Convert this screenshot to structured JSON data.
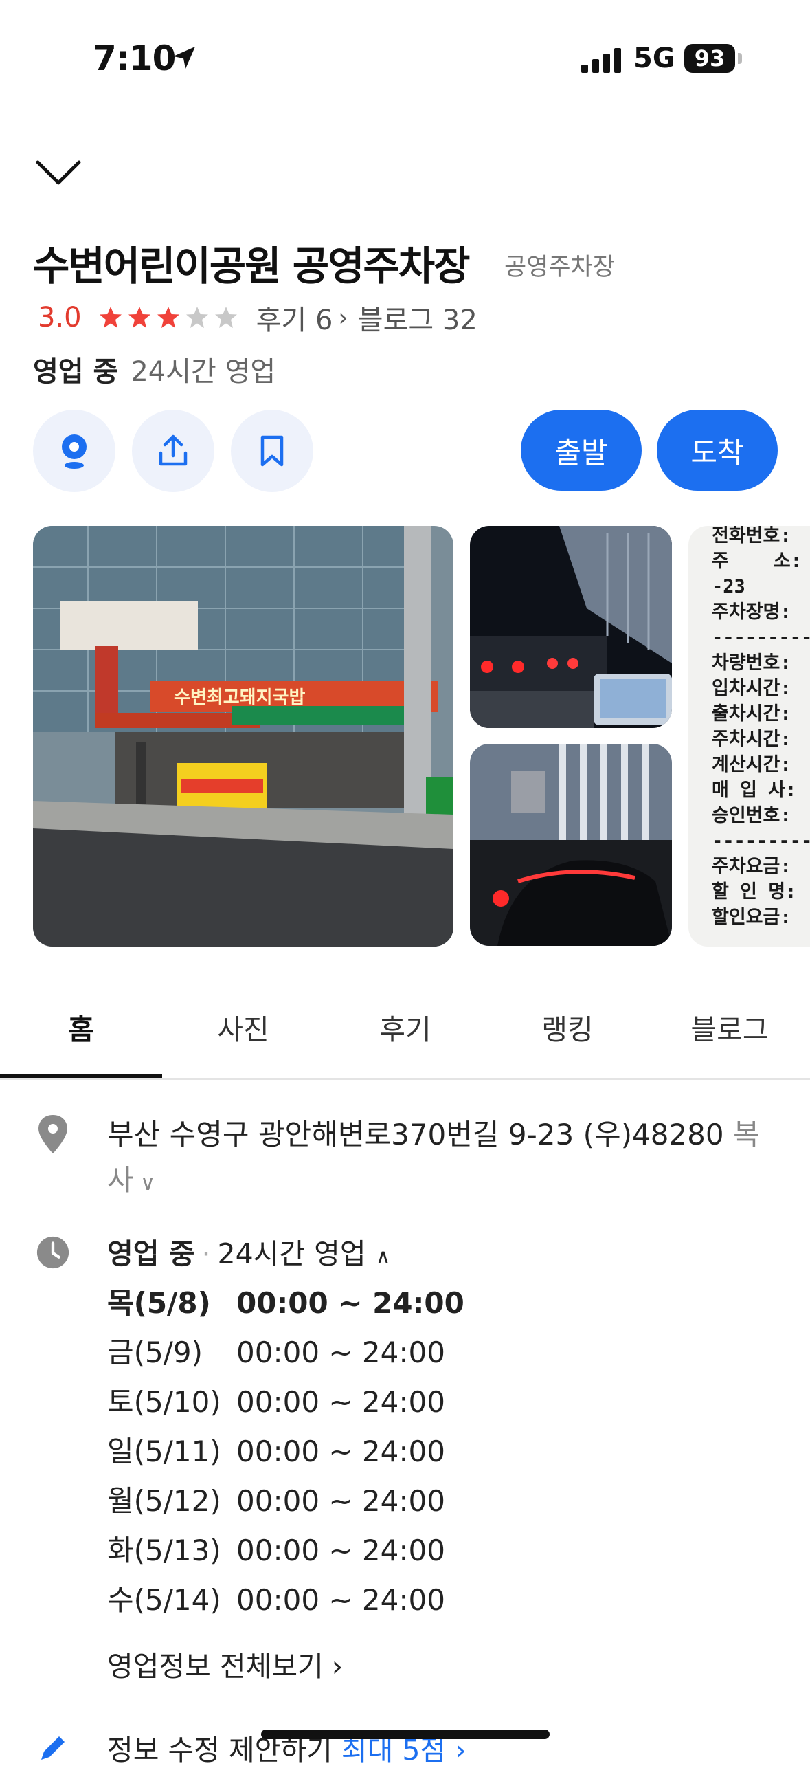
{
  "status_bar": {
    "time": "7:10",
    "network": "5G",
    "battery": "93"
  },
  "place": {
    "name": "수변어린이공원 공영주차장",
    "category": "공영주차장",
    "rating": "3.0",
    "stars_filled": 3,
    "stars_total": 5,
    "reviews_label": "후기 6",
    "blog_label": "블로그 32",
    "open_status": "영업 중",
    "open_hours_summary": "24시간 영업"
  },
  "actions": {
    "depart_label": "출발",
    "arrive_label": "도착"
  },
  "photos": {
    "main_sign": "수변최고돼지국밥",
    "receipt_lines": [
      "전화번호:",
      "주    소:",
      "-23",
      "주차장명:",
      "---------",
      "차량번호:",
      "입차시간:",
      "출차시간:",
      "주차시간:",
      "계산시간:",
      "매 입 사:",
      "승인번호:",
      "---------",
      "주차요금:",
      "할 인 명:",
      "할인요금:"
    ]
  },
  "tabs": [
    "홈",
    "사진",
    "후기",
    "랭킹",
    "블로그"
  ],
  "address": {
    "text": "부산 수영구 광안해변로370번길 9-23 (우)48280",
    "copy_label": "복사"
  },
  "hours": {
    "status": "영업 중",
    "summary": "24시간 영업",
    "rows": [
      {
        "day": "목(5/8)",
        "time": "00:00 ~ 24:00"
      },
      {
        "day": "금(5/9)",
        "time": "00:00 ~ 24:00"
      },
      {
        "day": "토(5/10)",
        "time": "00:00 ~ 24:00"
      },
      {
        "day": "일(5/11)",
        "time": "00:00 ~ 24:00"
      },
      {
        "day": "월(5/12)",
        "time": "00:00 ~ 24:00"
      },
      {
        "day": "화(5/13)",
        "time": "00:00 ~ 24:00"
      },
      {
        "day": "수(5/14)",
        "time": "00:00 ~ 24:00"
      }
    ],
    "more_label": "영업정보 전체보기"
  },
  "suggest": {
    "label": "정보 수정 제안하기",
    "limit": "최대 5점"
  },
  "colors": {
    "accent": "#1c6ff0",
    "rating": "#e23b2e",
    "star_filled": "#f0423a",
    "star_empty": "#c8c8c8"
  }
}
